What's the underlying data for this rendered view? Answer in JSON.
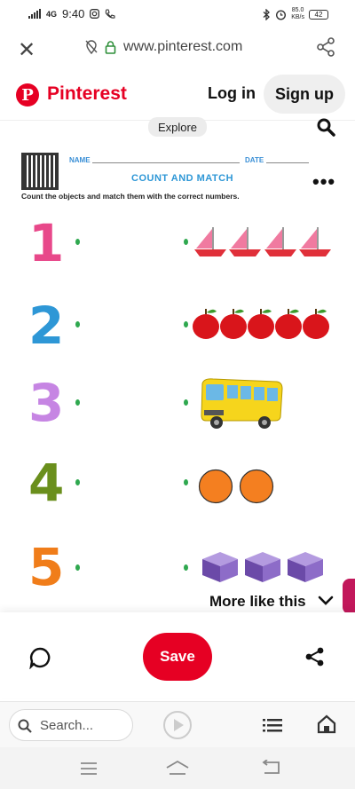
{
  "status_bar": {
    "time": "9:40",
    "network": "4G",
    "speed": "85.0",
    "speed_unit": "KB/s",
    "battery": "42"
  },
  "browser": {
    "url": "www.pinterest.com",
    "close_icon": "close-icon",
    "share_icon": "share-icon"
  },
  "header": {
    "brand": "Pinterest",
    "login_label": "Log in",
    "signup_label": "Sign up"
  },
  "explore_label": "Explore",
  "worksheet": {
    "name_label": "NAME",
    "date_label": "DATE",
    "title": "COUNT AND MATCH",
    "instruction": "Count the objects and match them with the correct numbers.",
    "numbers": [
      {
        "label": "1",
        "color": "#e8488a"
      },
      {
        "label": "2",
        "color": "#2e97d6"
      },
      {
        "label": "3",
        "color": "#c685e3"
      },
      {
        "label": "4",
        "color": "#6a8f1c"
      },
      {
        "label": "5",
        "color": "#f07d1a"
      }
    ],
    "objects": [
      {
        "name": "sailboat",
        "count": 4
      },
      {
        "name": "apple",
        "count": 5
      },
      {
        "name": "bus",
        "count": 1
      },
      {
        "name": "orange-circle",
        "count": 2
      },
      {
        "name": "purple-cube",
        "count": 3
      }
    ]
  },
  "more_like_this": "More like this",
  "actions": {
    "save_label": "Save"
  },
  "browser_bottom": {
    "search_placeholder": "Search..."
  },
  "colors": {
    "brand": "#e60023",
    "green_dot": "#2fa84f"
  }
}
